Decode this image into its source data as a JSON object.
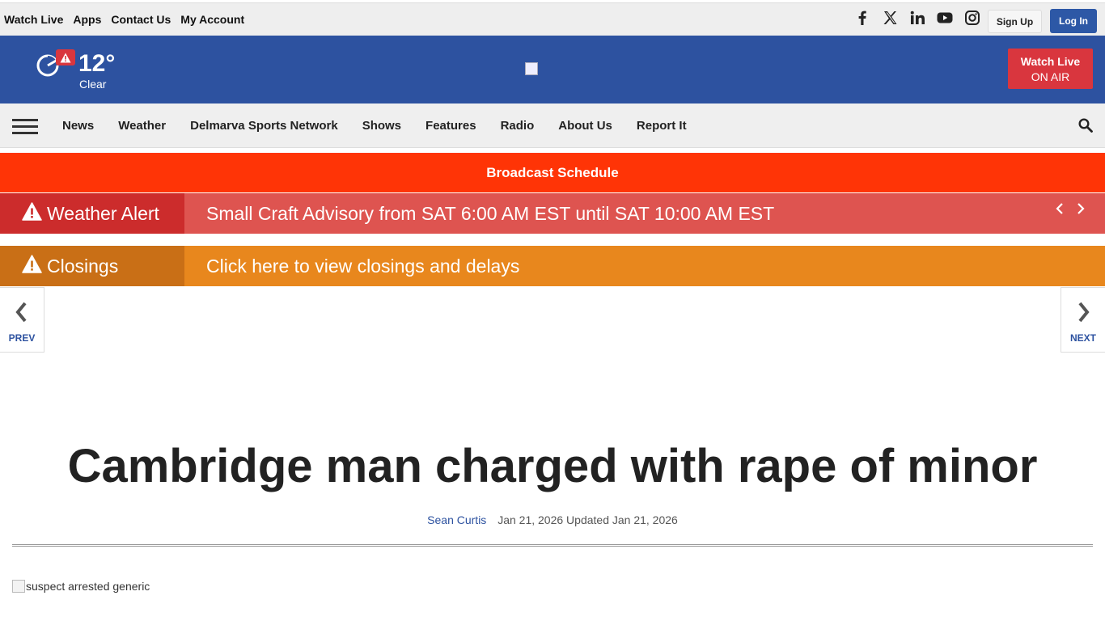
{
  "topbar": {
    "links": [
      "Watch Live",
      "Apps",
      "Contact Us",
      "My Account"
    ],
    "social_icons": [
      "facebook-icon",
      "x-icon",
      "linkedin-icon",
      "youtube-icon",
      "instagram-icon"
    ],
    "signup_label": "Sign Up",
    "login_label": "Log In"
  },
  "header": {
    "temperature": "12°",
    "condition": "Clear",
    "watch_live_line1": "Watch Live",
    "watch_live_line2": "ON AIR"
  },
  "nav": {
    "items": [
      "News",
      "Weather",
      "Delmarva Sports Network",
      "Shows",
      "Features",
      "Radio",
      "About Us",
      "Report It"
    ]
  },
  "broadcast": {
    "label": "Broadcast Schedule"
  },
  "weather_alert": {
    "label": "Weather Alert",
    "message": "Small Craft Advisory from SAT 6:00 AM EST until SAT 10:00 AM EST"
  },
  "closings": {
    "label": "Closings",
    "message": "Click here to view closings and delays"
  },
  "pager": {
    "prev_label": "PREV",
    "next_label": "NEXT"
  },
  "article": {
    "headline": "Cambridge man charged with rape of minor",
    "author": "Sean Curtis",
    "dates": "Jan 21, 2026 Updated Jan 21, 2026",
    "image_alt": "suspect arrested generic"
  },
  "colors": {
    "header_blue": "#2d52a0",
    "broadcast_red": "#ff3406",
    "alert_red": "#de5450",
    "closings_orange": "#e8871d",
    "login_blue": "#2d58a6"
  }
}
